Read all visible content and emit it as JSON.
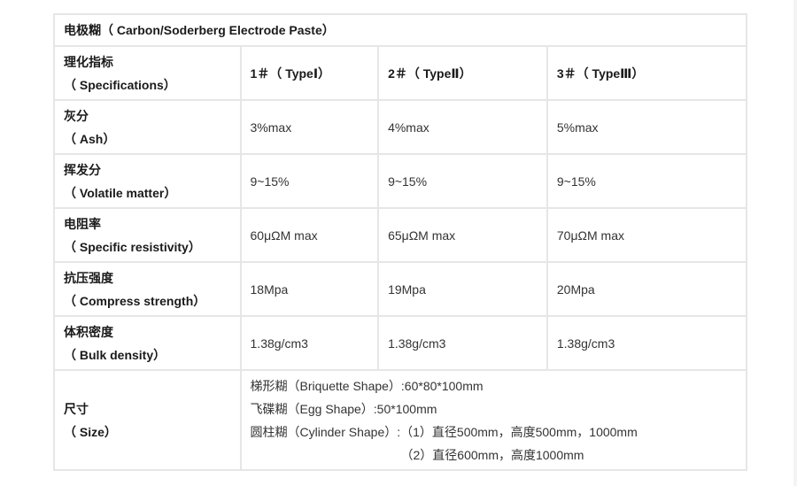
{
  "title": "电极糊（ Carbon/Soderberg Electrode Paste）",
  "header": {
    "label_cn": "理化指标",
    "label_en": "（ Specifications）",
    "types": [
      "1＃（ TypeⅠ）",
      "2＃（ TypeⅡ）",
      "3＃（ TypeⅢ）"
    ]
  },
  "rows": [
    {
      "label_cn": "灰分",
      "label_en": "（ Ash）",
      "values": [
        "3%max",
        "4%max",
        "5%max"
      ]
    },
    {
      "label_cn": "挥发分",
      "label_en": "（ Volatile matter）",
      "values": [
        "9~15%",
        "9~15%",
        "9~15%"
      ]
    },
    {
      "label_cn": "电阻率",
      "label_en": "（ Specific resistivity）",
      "values": [
        "60μΩM max",
        "65μΩM max",
        "70μΩM max"
      ]
    },
    {
      "label_cn": "抗压强度",
      "label_en": "（ Compress strength）",
      "values": [
        "18Mpa",
        "19Mpa",
        "20Mpa"
      ]
    },
    {
      "label_cn": "体积密度",
      "label_en": "（ Bulk density）",
      "values": [
        "1.38g/cm3",
        "1.38g/cm3",
        "1.38g/cm3"
      ]
    }
  ],
  "size": {
    "label_cn": "尺寸",
    "label_en": "（ Size）",
    "lines": [
      "梯形糊（Briquette Shape）:60*80*100mm",
      "飞碟糊（Egg Shape）:50*100mm",
      "圆柱糊（Cylinder Shape）:（1）直径500mm，高度500mm，1000mm",
      "（2）直径600mm，高度1000mm"
    ]
  }
}
